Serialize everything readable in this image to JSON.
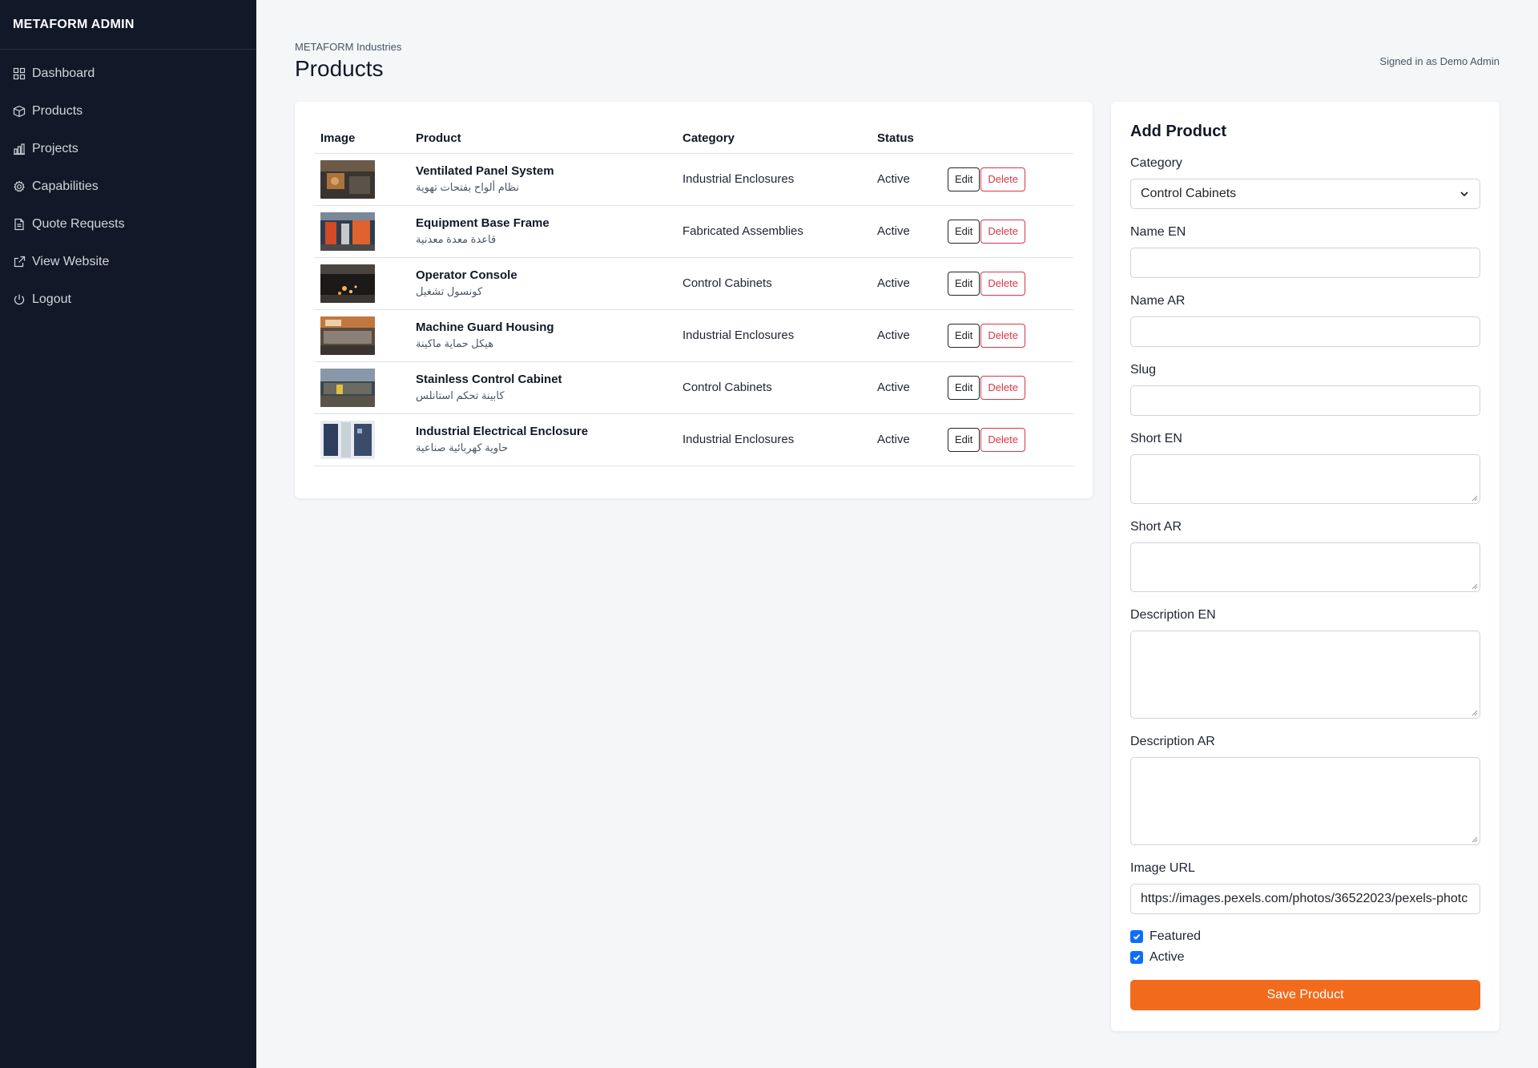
{
  "sidebar": {
    "brand": "METAFORM ADMIN",
    "items": [
      {
        "label": "Dashboard",
        "icon": "grid-icon"
      },
      {
        "label": "Products",
        "icon": "box-icon"
      },
      {
        "label": "Projects",
        "icon": "bar-chart-icon"
      },
      {
        "label": "Capabilities",
        "icon": "gear-icon"
      },
      {
        "label": "Quote Requests",
        "icon": "document-icon"
      },
      {
        "label": "View Website",
        "icon": "external-link-icon"
      },
      {
        "label": "Logout",
        "icon": "power-icon"
      }
    ]
  },
  "header": {
    "org": "METAFORM Industries",
    "title": "Products",
    "signed_in": "Signed in as Demo Admin"
  },
  "table": {
    "columns": [
      "Image",
      "Product",
      "Category",
      "Status"
    ],
    "edit_label": "Edit",
    "delete_label": "Delete",
    "rows": [
      {
        "name": "Ventilated Panel System",
        "name_ar": "نظام ألواح بفتحات تهوية",
        "category": "Industrial Enclosures",
        "status": "Active"
      },
      {
        "name": "Equipment Base Frame",
        "name_ar": "قاعدة معدة معدنية",
        "category": "Fabricated Assemblies",
        "status": "Active"
      },
      {
        "name": "Operator Console",
        "name_ar": "كونسول تشغيل",
        "category": "Control Cabinets",
        "status": "Active"
      },
      {
        "name": "Machine Guard Housing",
        "name_ar": "هيكل حماية ماكينة",
        "category": "Industrial Enclosures",
        "status": "Active"
      },
      {
        "name": "Stainless Control Cabinet",
        "name_ar": "كابينة تحكم استانلس",
        "category": "Control Cabinets",
        "status": "Active"
      },
      {
        "name": "Industrial Electrical Enclosure",
        "name_ar": "حاوية كهربائية صناعية",
        "category": "Industrial Enclosures",
        "status": "Active"
      }
    ]
  },
  "form": {
    "title": "Add Product",
    "category_label": "Category",
    "category_value": "Control Cabinets",
    "name_en_label": "Name EN",
    "name_ar_label": "Name AR",
    "slug_label": "Slug",
    "short_en_label": "Short EN",
    "short_ar_label": "Short AR",
    "desc_en_label": "Description EN",
    "desc_ar_label": "Description AR",
    "image_url_label": "Image URL",
    "image_url_value": "https://images.pexels.com/photos/36522023/pexels-photc",
    "featured_label": "Featured",
    "featured_checked": true,
    "active_label": "Active",
    "active_checked": true,
    "save_label": "Save Product"
  },
  "colors": {
    "sidebar_bg": "#111827",
    "accent": "#f26b1d",
    "danger": "#dc3545",
    "checkbox": "#0d6efd"
  }
}
